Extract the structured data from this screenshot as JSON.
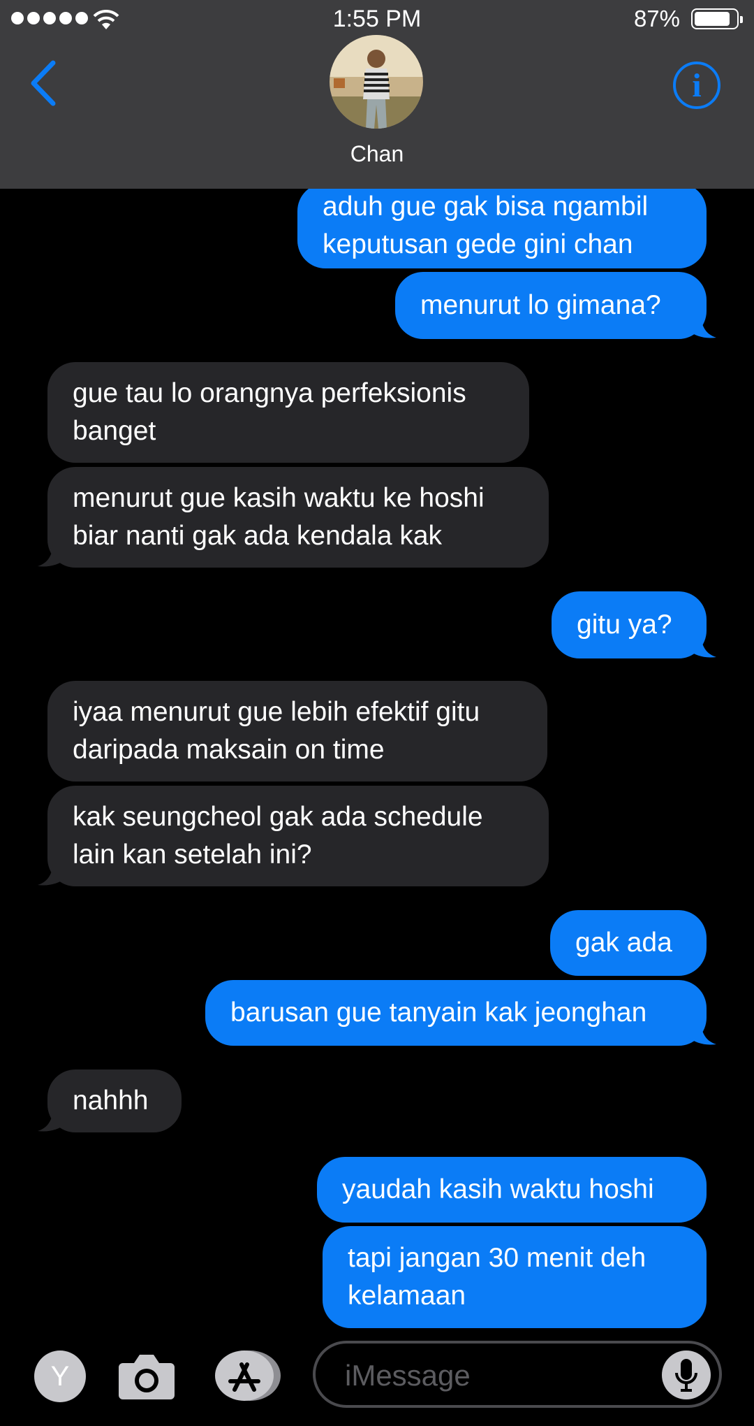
{
  "status_bar": {
    "time": "1:55 PM",
    "battery_percent": "87%",
    "battery_level": 0.87,
    "signal_bars": 5
  },
  "header": {
    "contact_name": "Chan",
    "back_icon": "chevron-left-icon",
    "info_icon_label": "i"
  },
  "messages": [
    {
      "from": "me",
      "lines": [
        "aduh gue gak bisa ngambil",
        "keputusan gede gini chan"
      ]
    },
    {
      "from": "me",
      "lines": [
        "menurut lo gimana?"
      ]
    },
    {
      "from": "them",
      "lines": [
        "gue tau lo orangnya perfeksionis",
        "banget"
      ]
    },
    {
      "from": "them",
      "lines": [
        "menurut gue kasih waktu ke hoshi",
        "biar nanti gak ada kendala kak"
      ]
    },
    {
      "from": "me",
      "lines": [
        "gitu ya?"
      ]
    },
    {
      "from": "them",
      "lines": [
        "iyaa menurut gue lebih efektif gitu",
        "daripada maksain on time"
      ]
    },
    {
      "from": "them",
      "lines": [
        "kak seungcheol gak ada schedule",
        "lain kan setelah ini?"
      ]
    },
    {
      "from": "me",
      "lines": [
        "gak ada"
      ]
    },
    {
      "from": "me",
      "lines": [
        "barusan gue tanyain kak jeonghan"
      ]
    },
    {
      "from": "them",
      "lines": [
        "nahhh"
      ]
    },
    {
      "from": "me",
      "lines": [
        "yaudah kasih waktu hoshi"
      ]
    },
    {
      "from": "me",
      "lines": [
        "tapi jangan 30 menit deh",
        "kelamaan"
      ]
    }
  ],
  "input_bar": {
    "app_button_label": "Y",
    "placeholder": "iMessage"
  },
  "colors": {
    "outgoing": "#0b7cf6",
    "incoming": "#262629",
    "header_bg": "#3d3d3f",
    "accent": "#0b7cf6"
  }
}
